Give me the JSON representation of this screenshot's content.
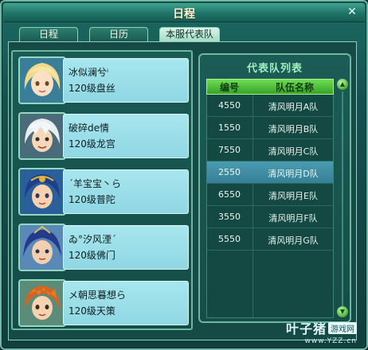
{
  "window": {
    "title": "日程",
    "close_glyph": "✕"
  },
  "tabs": [
    {
      "label": "日程",
      "active": false
    },
    {
      "label": "日历",
      "active": false
    },
    {
      "label": "本服代表队",
      "active": true
    }
  ],
  "members": [
    {
      "name": "冰似澜兮ⁱ",
      "level": "120级盘丝",
      "portrait": "female-blonde-portrait"
    },
    {
      "name": "破碎de情",
      "level": "120级龙宫",
      "portrait": "white-hair-male-portrait"
    },
    {
      "name": "ˊ羊宝宝丶ら",
      "level": "120级普陀",
      "portrait": "blue-hair-boy-portrait"
    },
    {
      "name": "ゐ°汐风湮ˊ",
      "level": "120级佛门",
      "portrait": "blue-hair-warrior-portrait"
    },
    {
      "name": "メ朝思暮想ら",
      "level": "120级天策",
      "portrait": "orange-hair-boy-portrait"
    }
  ],
  "team_list": {
    "title": "代表队列表",
    "headers": {
      "number": "编号",
      "name": "队伍名称"
    },
    "rows": [
      {
        "number": "4550",
        "name": "清风明月A队",
        "selected": false
      },
      {
        "number": "1550",
        "name": "清风明月B队",
        "selected": false
      },
      {
        "number": "7550",
        "name": "清风明月C队",
        "selected": false
      },
      {
        "number": "2550",
        "name": "清风明月D队",
        "selected": true
      },
      {
        "number": "6550",
        "name": "清风明月E队",
        "selected": false
      },
      {
        "number": "3550",
        "name": "清风明月F队",
        "selected": false
      },
      {
        "number": "5550",
        "name": "清风明月G队",
        "selected": false
      }
    ]
  },
  "watermark": {
    "main": "叶子猪",
    "badge": "游戏网",
    "url": "www.YZZ.cn"
  }
}
